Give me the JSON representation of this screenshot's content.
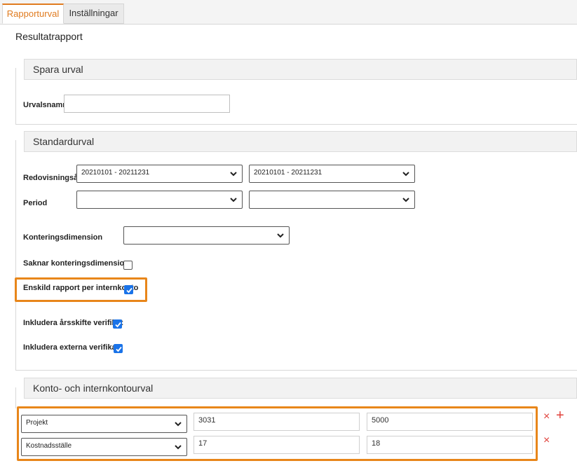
{
  "tabs": [
    {
      "label": "Rapporturval"
    },
    {
      "label": "Inställningar"
    }
  ],
  "page_title": "Resultatrapport",
  "sections": {
    "spara": {
      "legend": "Spara urval",
      "urvalsnamn_label": "Urvalsnamn",
      "urvalsnamn_value": ""
    },
    "standard": {
      "legend": "Standardurval",
      "redovisningsar_label": "Redovisningsår",
      "redovisningsar_from": "20210101 - 20211231",
      "redovisningsar_to": "20210101 - 20211231",
      "period_label": "Period",
      "period_from": "",
      "period_to": "",
      "konteringsdimension_label": "Konteringsdimension",
      "konteringsdimension_value": "",
      "saknar_label": "Saknar konteringsdimension",
      "saknar_checked": false,
      "enskild_label": "Enskild rapport per internkonto",
      "enskild_checked": true,
      "arsskifte_label": "Inkludera årsskifte verifikat",
      "arsskifte_checked": true,
      "externa_label": "Inkludera externa verifikat",
      "externa_checked": true
    },
    "konto": {
      "legend": "Konto- och internkontourval",
      "rows": [
        {
          "type": "Projekt",
          "from": "3031",
          "to": "5000"
        },
        {
          "type": "Kostnadsställe",
          "from": "17",
          "to": "18"
        }
      ]
    }
  },
  "colors": {
    "accent": "#e8861a",
    "checkbox": "#1a73e8",
    "remove": "#e0403a"
  },
  "icons": {
    "remove": "×",
    "add": "+"
  }
}
